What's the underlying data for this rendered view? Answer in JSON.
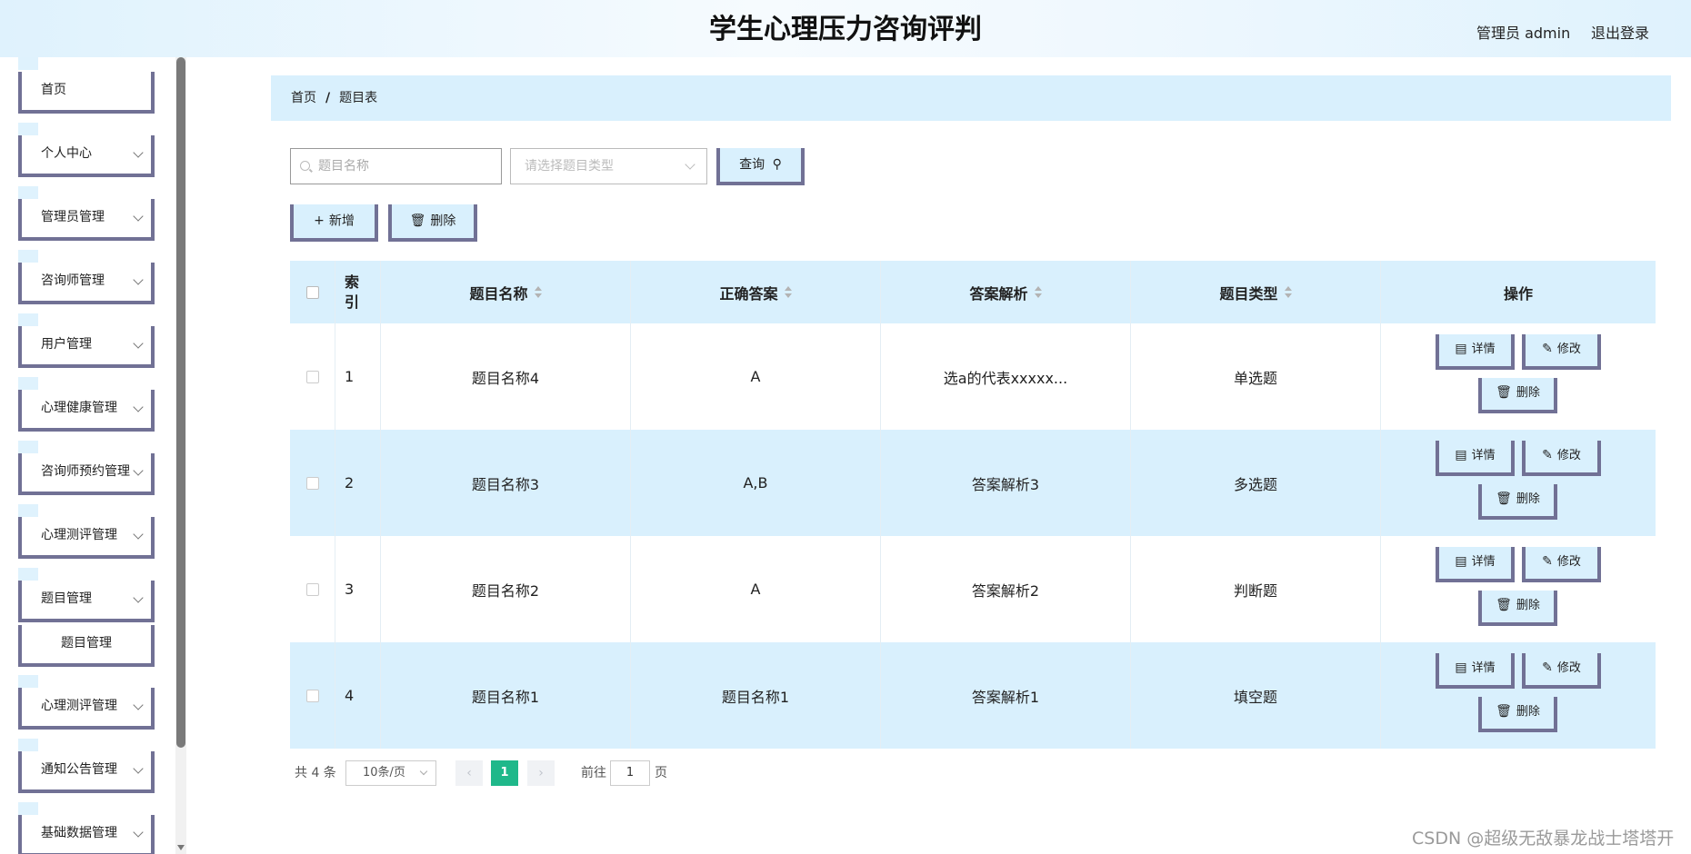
{
  "header": {
    "title": "学生心理压力咨询评判",
    "user": "管理员 admin",
    "logout": "退出登录"
  },
  "sidebar": {
    "items": [
      {
        "label": "首页"
      },
      {
        "label": "个人中心"
      },
      {
        "label": "管理员管理"
      },
      {
        "label": "咨询师管理"
      },
      {
        "label": "用户管理"
      },
      {
        "label": "心理健康管理"
      },
      {
        "label": "咨询师预约管理"
      },
      {
        "label": "心理测评管理"
      },
      {
        "label": "题目管理"
      },
      {
        "label": "题目管理"
      },
      {
        "label": "心理测评管理"
      },
      {
        "label": "通知公告管理"
      },
      {
        "label": "基础数据管理"
      }
    ]
  },
  "breadcrumb": {
    "home": "首页",
    "sep": "/",
    "current": "题目表"
  },
  "search": {
    "name_placeholder": "题目名称",
    "type_placeholder": "请选择题目类型",
    "query_label": "查询"
  },
  "actions": {
    "add_label": "新增",
    "delete_label": "删除"
  },
  "table": {
    "headers": {
      "index_top": "索",
      "index_bottom": "引",
      "name": "题目名称",
      "answer": "正确答案",
      "analysis": "答案解析",
      "type": "题目类型",
      "ops": "操作"
    },
    "rows": [
      {
        "index": "1",
        "name": "题目名称4",
        "answer": "A",
        "analysis": "选a的代表xxxxx...",
        "type": "单选题"
      },
      {
        "index": "2",
        "name": "题目名称3",
        "answer": "A,B",
        "analysis": "答案解析3",
        "type": "多选题"
      },
      {
        "index": "3",
        "name": "题目名称2",
        "answer": "A",
        "analysis": "答案解析2",
        "type": "判断题"
      },
      {
        "index": "4",
        "name": "题目名称1",
        "answer": "题目名称1",
        "analysis": "答案解析1",
        "type": "填空题"
      }
    ],
    "op_labels": {
      "detail": "详情",
      "edit": "修改",
      "delete": "删除"
    }
  },
  "pagination": {
    "total": "共 4 条",
    "page_size": "10条/页",
    "current": "1",
    "goto_label": "前往",
    "goto_value": "1",
    "goto_unit": "页"
  },
  "watermark": "CSDN @超级无敌暴龙战士塔塔开",
  "colors": {
    "accent_border": "#717195",
    "light_blue": "#d9f0fd",
    "pager_active": "#1fb88a"
  }
}
